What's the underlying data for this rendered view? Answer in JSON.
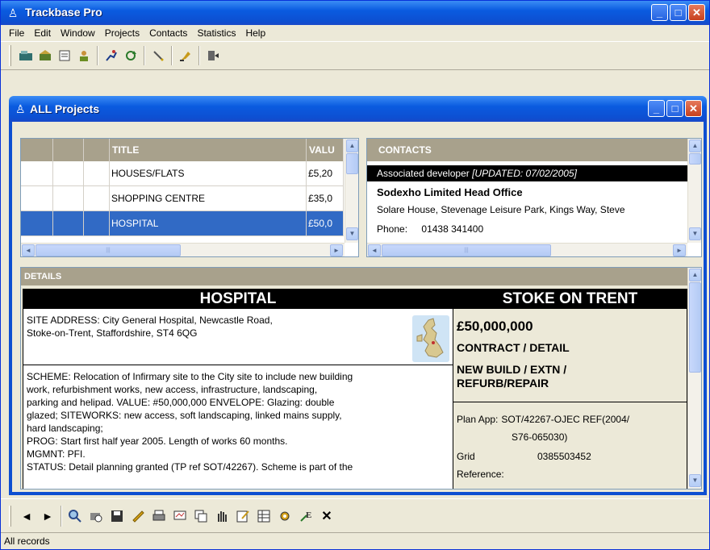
{
  "app": {
    "title": "Trackbase Pro"
  },
  "menu": [
    "File",
    "Edit",
    "Window",
    "Projects",
    "Contacts",
    "Statistics",
    "Help"
  ],
  "toolbar_icons": [
    "projects-icon",
    "new-project-icon",
    "notes-icon",
    "contacts-icon",
    "run-icon",
    "refresh-icon",
    "pen-icon",
    "highlighter-icon",
    "exit-icon"
  ],
  "child": {
    "title": "ALL Projects"
  },
  "grid": {
    "headers": [
      "",
      "",
      "",
      "TITLE",
      "VALU"
    ],
    "rows": [
      {
        "title": "HOUSES/FLATS",
        "value": "£5,20"
      },
      {
        "title": "SHOPPING CENTRE",
        "value": "£35,0"
      },
      {
        "title": "HOSPITAL",
        "value": "£50,0",
        "selected": true
      }
    ]
  },
  "contacts": {
    "header": "CONTACTS",
    "role": "Associated developer",
    "updated": "[UPDATED: 07/02/2005]",
    "company": "Sodexho Limited Head Office",
    "address": "Solare House, Stevenage Leisure Park, Kings Way, Steve",
    "phone_label": "Phone:",
    "phone": "01438 341400"
  },
  "details": {
    "header": "DETAILS",
    "title": "HOSPITAL",
    "site_line1": "SITE ADDRESS: City General Hospital, Newcastle Road,",
    "site_line2": "Stoke-on-Trent, Staffordshire, ST4 6QG",
    "scheme_lines": [
      "SCHEME: Relocation of Infirmary site to the City site to  include new building",
      "work, refurbishment works,  new access, infrastructure, landscaping,",
      "parking  and helipad.  VALUE: #50,000,000  ENVELOPE: Glazing: double",
      "glazed; SITEWORKS: new access, soft landscaping, linked mains supply,",
      "hard landscaping;",
      "PROG: Start first half year 2005. Length of works 60 months.",
      "MGMNT: PFI.",
      "STATUS: Detail planning granted (TP ref SOT/42267).  Scheme is part of the"
    ],
    "location": "STOKE ON TRENT",
    "value": "£50,000,000",
    "stage": "CONTRACT / DETAIL",
    "type_line1": "NEW BUILD / EXTN /",
    "type_line2": "REFURB/REPAIR",
    "plan_label": "Plan App:",
    "plan_value1": "SOT/42267-OJEC REF(2004/",
    "plan_value2": "S76-065030)",
    "grid_label1": "Grid",
    "grid_label2": "Reference:",
    "grid_value": "0385503452"
  },
  "bottom_toolbar": [
    "◄",
    "►",
    "find-icon",
    "print-preview-icon",
    "save-icon",
    "filter-icon",
    "print-icon",
    "report-icon",
    "copy-icon",
    "hand-icon",
    "edit-icon",
    "table-icon",
    "tools-icon",
    "export-icon",
    "✕"
  ],
  "status": {
    "text": "All records"
  }
}
